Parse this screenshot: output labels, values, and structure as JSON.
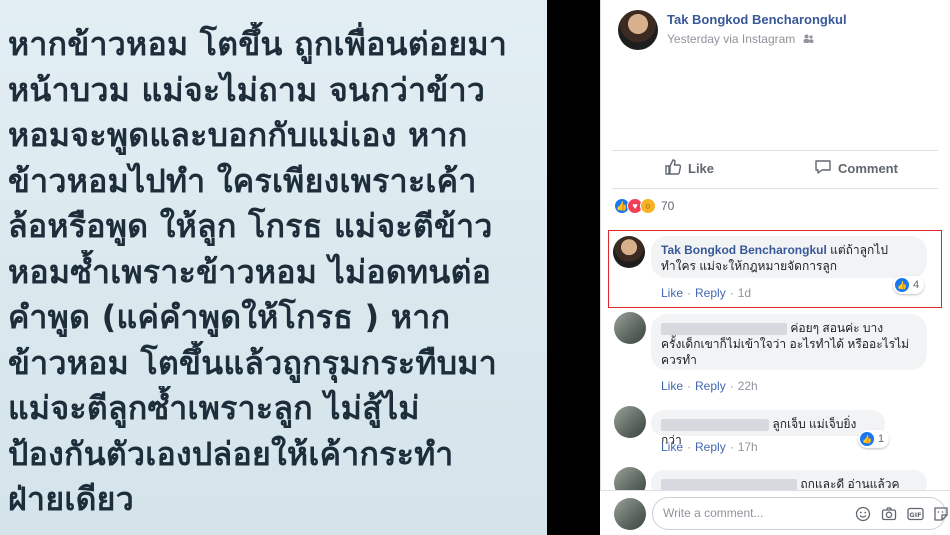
{
  "photo": {
    "lines": [
      "หากข้าวหอม โตขึ้น ถูกเพื่อนต่อยมา",
      "หน้าบวม แม่จะไม่ถาม จนกว่าข้าว",
      "หอมจะพูดและบอกกับแม่เอง หาก",
      "ข้าวหอมไปทำ ใครเพียงเพราะเค้า",
      "ล้อหรือพูด ให้ลูก โกรธ แม่จะตีข้าว",
      "หอมซ้ำเพราะข้าวหอม ไม่อดทนต่อ",
      "คำพูด (แค่คำพูดให้โกรธ ) หาก",
      "ข้าวหอม โตขึ้นแล้วถูกรุมกระทืบมา",
      "แม่จะตีลูกซ้ำเพราะลูก ไม่สู้ไม่",
      "ป้องกันตัวเองปล่อยให้เค้ากระทำ",
      "ฝ่ายเดียว"
    ]
  },
  "post": {
    "author": "Tak Bongkod Bencharongkul",
    "meta": "Yesterday via Instagram",
    "like_label": "Like",
    "comment_label": "Comment",
    "reaction_count": "70",
    "reaction_icons": [
      "like-icon",
      "love-icon",
      "wow-icon"
    ]
  },
  "comments": [
    {
      "author": "Tak Bongkod Bencharongkul",
      "text_line1": "แต่ถ้าลูกไป",
      "text_line2": "ทำใคร แม่จะให้กฎหมายจัดการลูก",
      "like": "Like",
      "reply": "Reply",
      "time": "1d",
      "likes": "4"
    },
    {
      "text_line1": "ค่อยๆ สอนค่ะ บาง",
      "text_line2": "ครั้งเด็กเขาก็ไม่เข้าใจว่า อะไรทำได้ หรืออะไรไม่",
      "text_line3": "ควรทำ",
      "like": "Like",
      "reply": "Reply",
      "time": "22h"
    },
    {
      "text_line1": "ลูกเจ็บ แม่เจ็บยิ่งกว่า",
      "like": "Like",
      "reply": "Reply",
      "time": "17h",
      "likes": "1"
    },
    {
      "text_line1": "ถกและดี อ่านแล้วค"
    }
  ],
  "composer": {
    "placeholder": "Write a comment...",
    "icons": [
      "emoji-icon",
      "camera-icon",
      "gif-icon",
      "sticker-icon"
    ]
  },
  "colors": {
    "link": "#385898",
    "action_link": "#4267b2",
    "highlight_border": "#e0262b",
    "like_blue": "#1877f2"
  }
}
